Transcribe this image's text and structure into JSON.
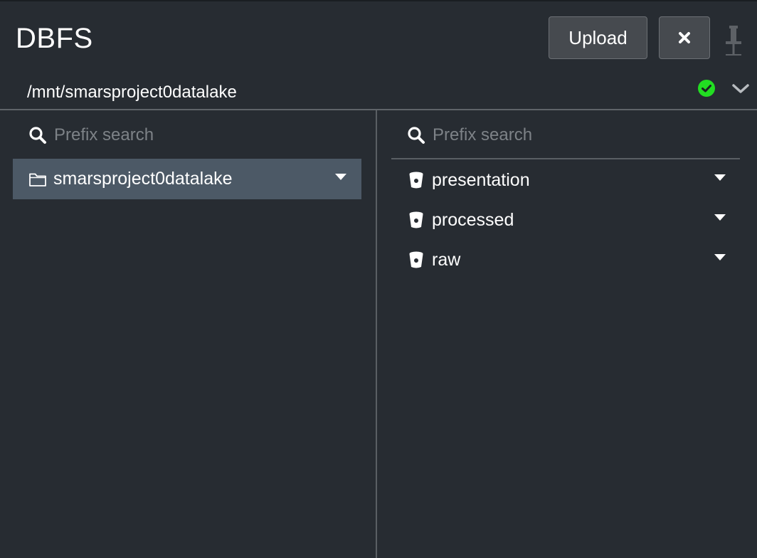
{
  "header": {
    "title": "DBFS",
    "upload_label": "Upload"
  },
  "path": {
    "current": "/mnt/smarsproject0datalake"
  },
  "left_pane": {
    "search_placeholder": "Prefix search",
    "items": [
      {
        "label": "smarsproject0datalake",
        "icon": "folder-icon",
        "selected": true
      }
    ]
  },
  "right_pane": {
    "search_placeholder": "Prefix search",
    "items": [
      {
        "label": "presentation",
        "icon": "bucket-icon"
      },
      {
        "label": "processed",
        "icon": "bucket-icon"
      },
      {
        "label": "raw",
        "icon": "bucket-icon"
      }
    ]
  },
  "colors": {
    "background": "#272c32",
    "selected_row": "#4c5966",
    "status_ok": "#22dd22",
    "button_bg": "#464a4f"
  }
}
